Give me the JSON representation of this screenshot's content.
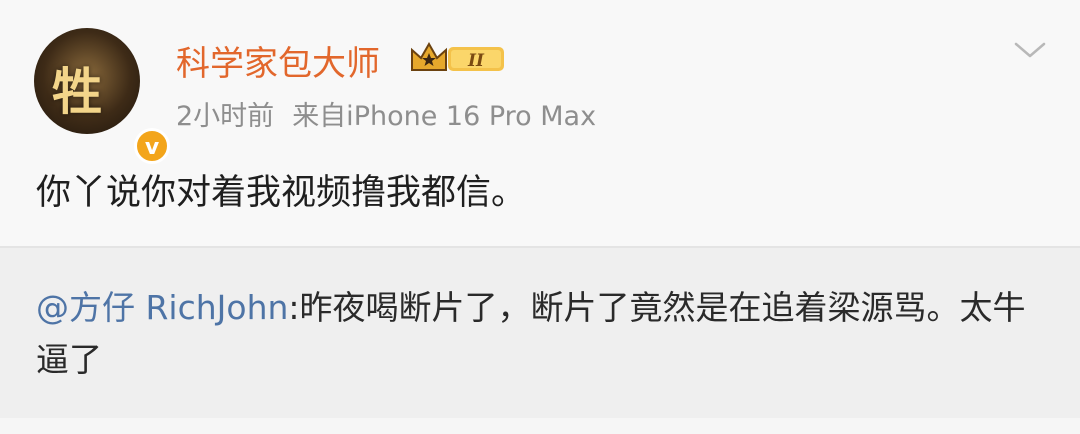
{
  "user": {
    "name": "科学家包大师",
    "avatar_glyph": "牲",
    "verified_mark": "v",
    "badge_level": "II"
  },
  "meta": {
    "time": "2小时前",
    "source": "来自iPhone 16 Pro Max"
  },
  "post": {
    "text": "你丫说你对着我视频撸我都信。"
  },
  "repost": {
    "mention": "@方仔 RichJohn",
    "text": ":昨夜喝断片了，断片了竟然是在追着梁源骂。太牛逼了"
  },
  "colors": {
    "username": "#e2672c",
    "mention": "#4e74a6",
    "meta": "#8e8e8e",
    "verified": "#f3a51b"
  }
}
